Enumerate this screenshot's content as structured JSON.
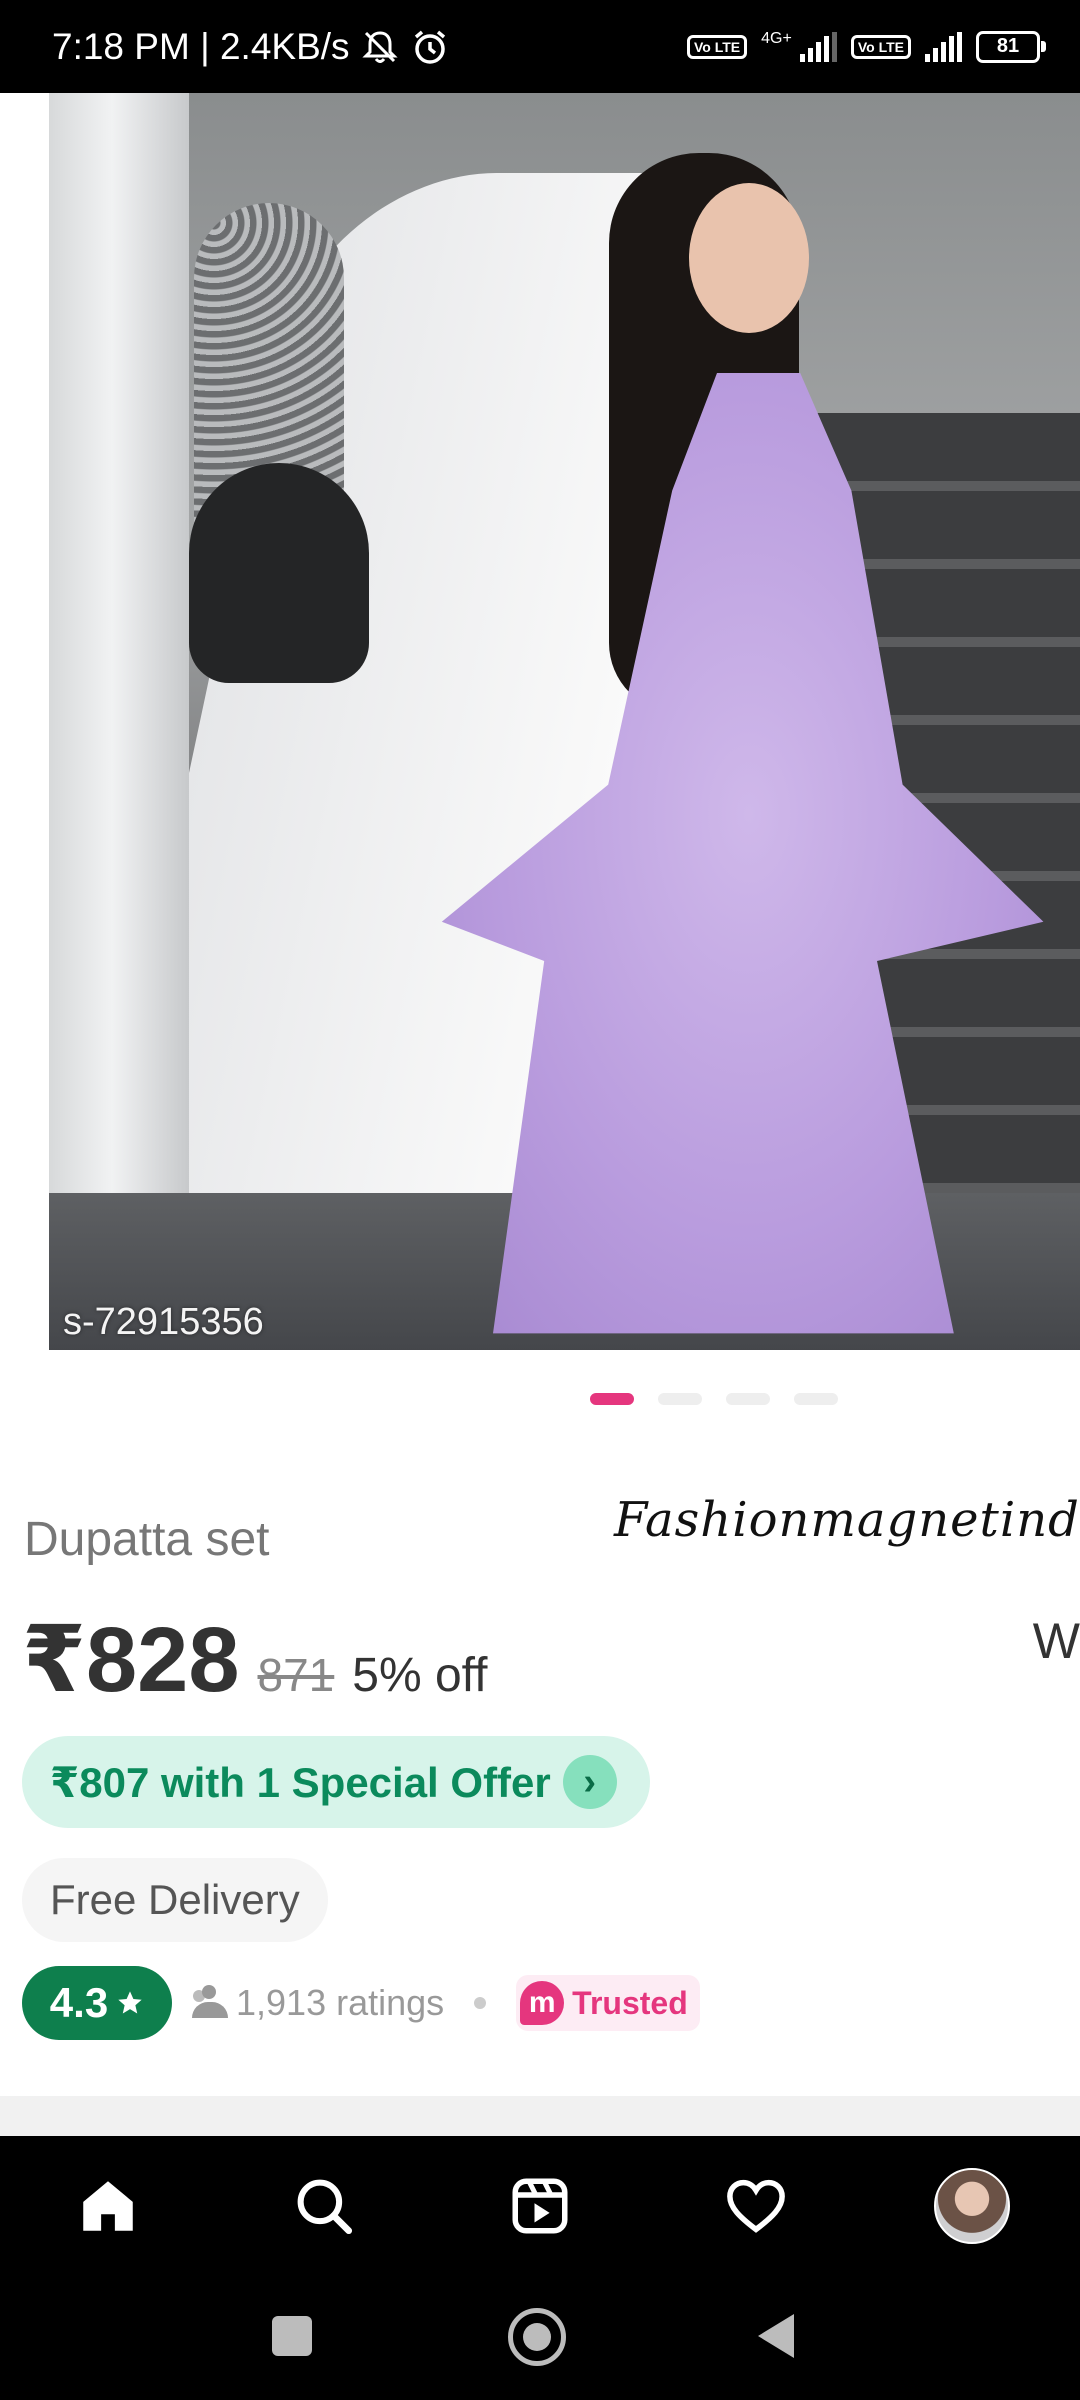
{
  "status_bar": {
    "time_speed": "7:18 PM | 2.4KB/s",
    "volte_1": "Vo LTE",
    "network_1": "4G+",
    "volte_2": "Vo LTE",
    "battery": "81",
    "icons": [
      "mute-icon",
      "alarm-icon",
      "signal-icon",
      "battery-icon"
    ]
  },
  "product_image": {
    "sku": "s-72915356",
    "carousel": {
      "count": 4,
      "active_index": 0
    }
  },
  "product": {
    "title": "Dupatta set",
    "seller_watermark": "Fashionmagnetindia",
    "price": "₹828",
    "mrp": "871",
    "discount": "5% off",
    "edge_text": "W",
    "offer": "₹807 with 1 Special Offer",
    "delivery": "Free Delivery",
    "rating": "4.3",
    "ratings_count": "1,913 ratings",
    "trusted_label": "Trusted",
    "trusted_logo": "m"
  },
  "colors": {
    "accent_pink": "#e5367e",
    "offer_green": "#0b8a5c",
    "rating_green": "#0e7f4d"
  },
  "bottom_nav": {
    "items": [
      "home-icon",
      "search-icon",
      "reels-icon",
      "heart-icon",
      "profile-avatar"
    ],
    "active": "home-icon"
  }
}
